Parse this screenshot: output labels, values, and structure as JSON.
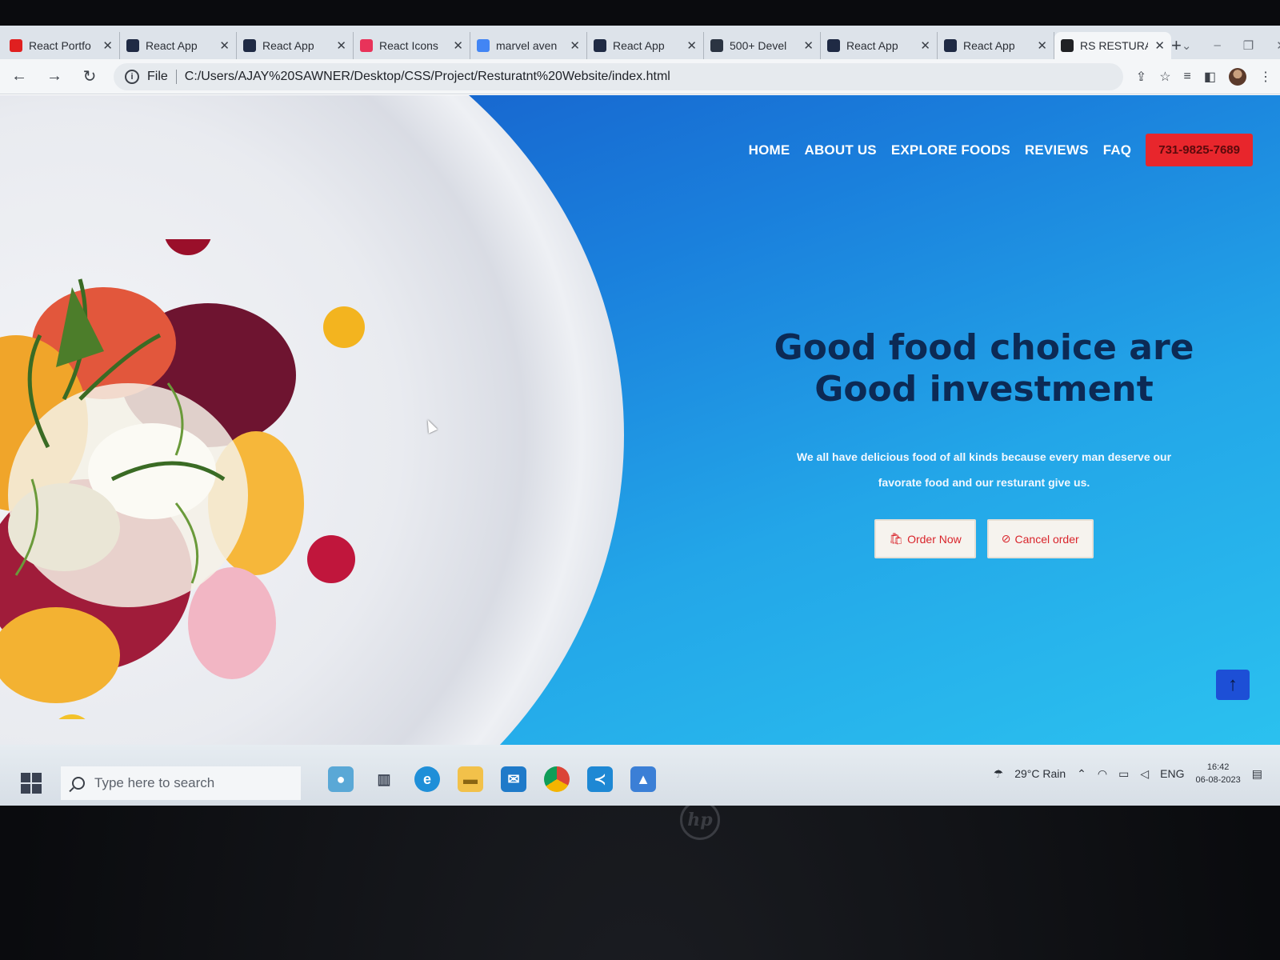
{
  "browser": {
    "tabs": [
      {
        "title": "React Portfo",
        "favicon": "youtube-icon",
        "color": "#e02020"
      },
      {
        "title": "React App",
        "favicon": "react-app-icon",
        "color": "#1f2a44"
      },
      {
        "title": "React App",
        "favicon": "react-app-icon",
        "color": "#1f2a44"
      },
      {
        "title": "React Icons",
        "favicon": "react-icons-icon",
        "color": "#e8335a"
      },
      {
        "title": "marvel aven",
        "favicon": "google-icon",
        "color": "#4285f4"
      },
      {
        "title": "React App",
        "favicon": "react-app-icon",
        "color": "#1f2a44"
      },
      {
        "title": "500+ Devel",
        "favicon": "dev-icon",
        "color": "#2b3442"
      },
      {
        "title": "React App",
        "favicon": "react-app-icon",
        "color": "#1f2a44"
      },
      {
        "title": "React App",
        "favicon": "react-app-icon",
        "color": "#1f2a44"
      },
      {
        "title": "RS RESTURA",
        "favicon": "globe-icon",
        "color": "#202124",
        "active": true
      }
    ],
    "close_glyph": "✕",
    "new_tab_glyph": "+",
    "url_scheme_label": "File",
    "url": "C:/Users/AJAY%20SAWNER/Desktop/CSS/Project/Resturatnt%20Website/index.html"
  },
  "site": {
    "nav": [
      "HOME",
      "ABOUT US",
      "EXPLORE FOODS",
      "REVIEWS",
      "FAQ"
    ],
    "phone": "731-9825-7689",
    "hero_title_line1": "Good food choice are",
    "hero_title_line2": "Good investment",
    "hero_text": "We all have delicious food of all kinds because every man deserve our favorate food and our resturant give us.",
    "order_button": "Order Now",
    "cancel_button": "Cancel order",
    "accent_color": "#e8262c",
    "background_colors": [
      "#1557c7",
      "#2bc1ef"
    ]
  },
  "taskbar": {
    "search_placeholder": "Type here to search",
    "apps": [
      "edge-icon",
      "file-explorer-icon",
      "mail-icon",
      "chrome-icon",
      "vscode-icon",
      "photos-icon"
    ],
    "weather": "29°C Rain",
    "language": "ENG",
    "time": "16:42",
    "date": "06-08-2023"
  },
  "device_brand": "hp"
}
